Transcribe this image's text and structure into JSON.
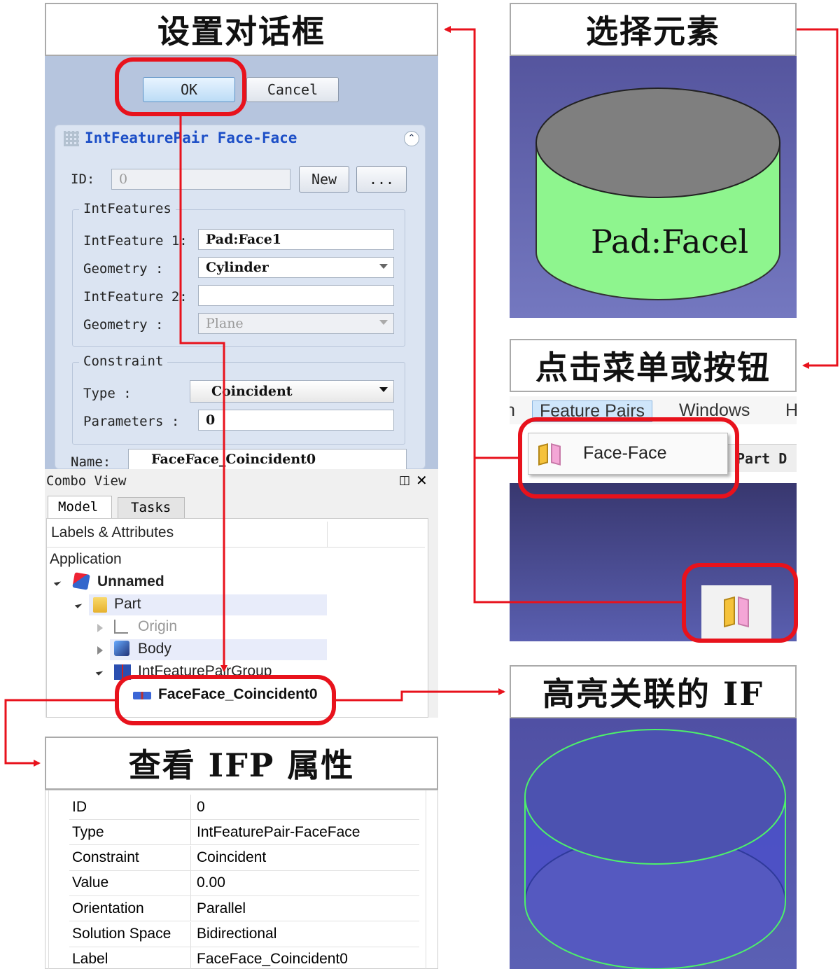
{
  "titles": {
    "dialog": "设置对话框",
    "select": "选择元素",
    "menu": "点击菜单或按钮",
    "highlight": "高亮关联的 IF",
    "props": "查看 IFP 属性"
  },
  "dialog": {
    "ok": "OK",
    "cancel": "Cancel",
    "panel_title": "IntFeaturePair Face-Face",
    "id_label": "ID:",
    "id_value": "0",
    "new_btn": "New",
    "more_btn": "...",
    "intfeatures_group": "IntFeatures",
    "intfeature1_label": "IntFeature 1:",
    "intfeature1_value": "Pad:Face1",
    "geometry1_label": "Geometry :",
    "geometry1_value": "Cylinder",
    "intfeature2_label": "IntFeature 2:",
    "intfeature2_value": "",
    "geometry2_label": "Geometry :",
    "geometry2_value": "Plane",
    "constraint_group": "Constraint",
    "type_label": "Type :",
    "type_value": "Coincident",
    "params_label": "Parameters :",
    "params_value": "0",
    "name_label": "Name:",
    "name_value": "FaceFace_Coincident0"
  },
  "combo": {
    "title": "Combo View",
    "tab_model": "Model",
    "tab_tasks": "Tasks",
    "header": "Labels & Attributes",
    "application": "Application",
    "unnamed": "Unnamed",
    "part": "Part",
    "origin": "Origin",
    "body": "Body",
    "group": "IntFeaturePairGroup",
    "item": "FaceFace_Coincident0"
  },
  "props": [
    {
      "k": "ID",
      "v": "0"
    },
    {
      "k": "Type",
      "v": "IntFeaturePair-FaceFace"
    },
    {
      "k": "Constraint",
      "v": "Coincident"
    },
    {
      "k": "Value",
      "v": "0.00"
    },
    {
      "k": "Orientation",
      "v": "Parallel"
    },
    {
      "k": "Solution Space",
      "v": "Bidirectional"
    },
    {
      "k": "Label",
      "v": "FaceFace_Coincident0"
    }
  ],
  "select_view": {
    "face_label": "Pad:Facel"
  },
  "menu_view": {
    "menu_item1": "n",
    "menu_feature_pairs": "Feature Pairs",
    "menu_windows": "Windows",
    "menu_h": "H",
    "submenu_face_face": "Face-Face",
    "toolbar_text": "Part D"
  },
  "colors": {
    "highlight_red": "#e8121c",
    "cylinder_side": "#88f088",
    "cylinder_top": "#7f7f7f",
    "view_bg": "#5257a6"
  }
}
